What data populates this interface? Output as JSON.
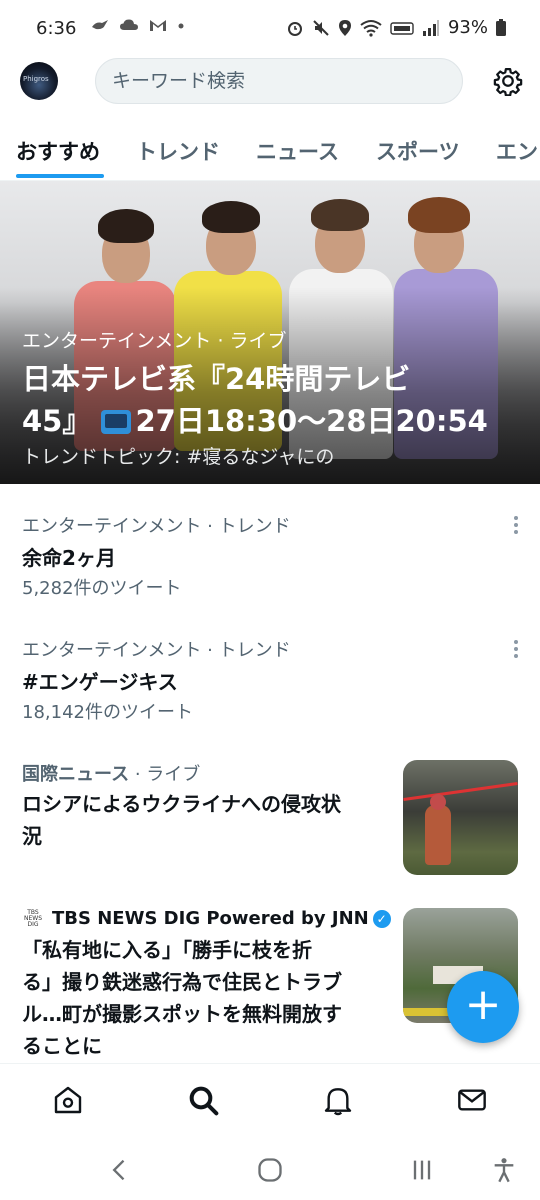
{
  "status_bar": {
    "time": "6:36",
    "battery": "93%"
  },
  "header": {
    "avatar_text": "Phigros",
    "search_placeholder": "キーワード検索"
  },
  "tabs": [
    {
      "label": "おすすめ"
    },
    {
      "label": "トレンド"
    },
    {
      "label": "ニュース"
    },
    {
      "label": "スポーツ"
    },
    {
      "label": "エン"
    }
  ],
  "hero": {
    "category": "エンターテインメント · ライブ",
    "title_line1": "日本テレビ系『24時間テレビ",
    "title_line2": "45』",
    "title_line2_rest": "27日18:30〜28日20:54",
    "subtitle": "トレンドトピック: #寝るなジャにの"
  },
  "trends": [
    {
      "category": "エンターテインメント · トレンド",
      "topic": "余命2ヶ月",
      "count": "5,282件のツイート"
    },
    {
      "category": "エンターテインメント · トレンド",
      "topic": "#エンゲージキス",
      "count": "18,142件のツイート"
    }
  ],
  "news": [
    {
      "category": "国際ニュース",
      "live": " · ライブ",
      "title_line1": "ロシアによるウクライナへの侵攻状",
      "title_line2": "況"
    },
    {
      "source_logo": "TBS NEWS DIG",
      "source": "TBS NEWS DIG Powered by JNN",
      "title_line1": "「私有地に入る」「勝手に枝を折",
      "title_line2": "る」撮り鉄迷惑行為で住民とトラブ",
      "title_line3": "ル…町が撮影スポットを無料開放す",
      "title_line4": "ることに"
    }
  ],
  "fab": {
    "label": "+"
  },
  "colors": {
    "accent": "#1d9bf0",
    "text": "#0f1419",
    "muted": "#536471"
  }
}
